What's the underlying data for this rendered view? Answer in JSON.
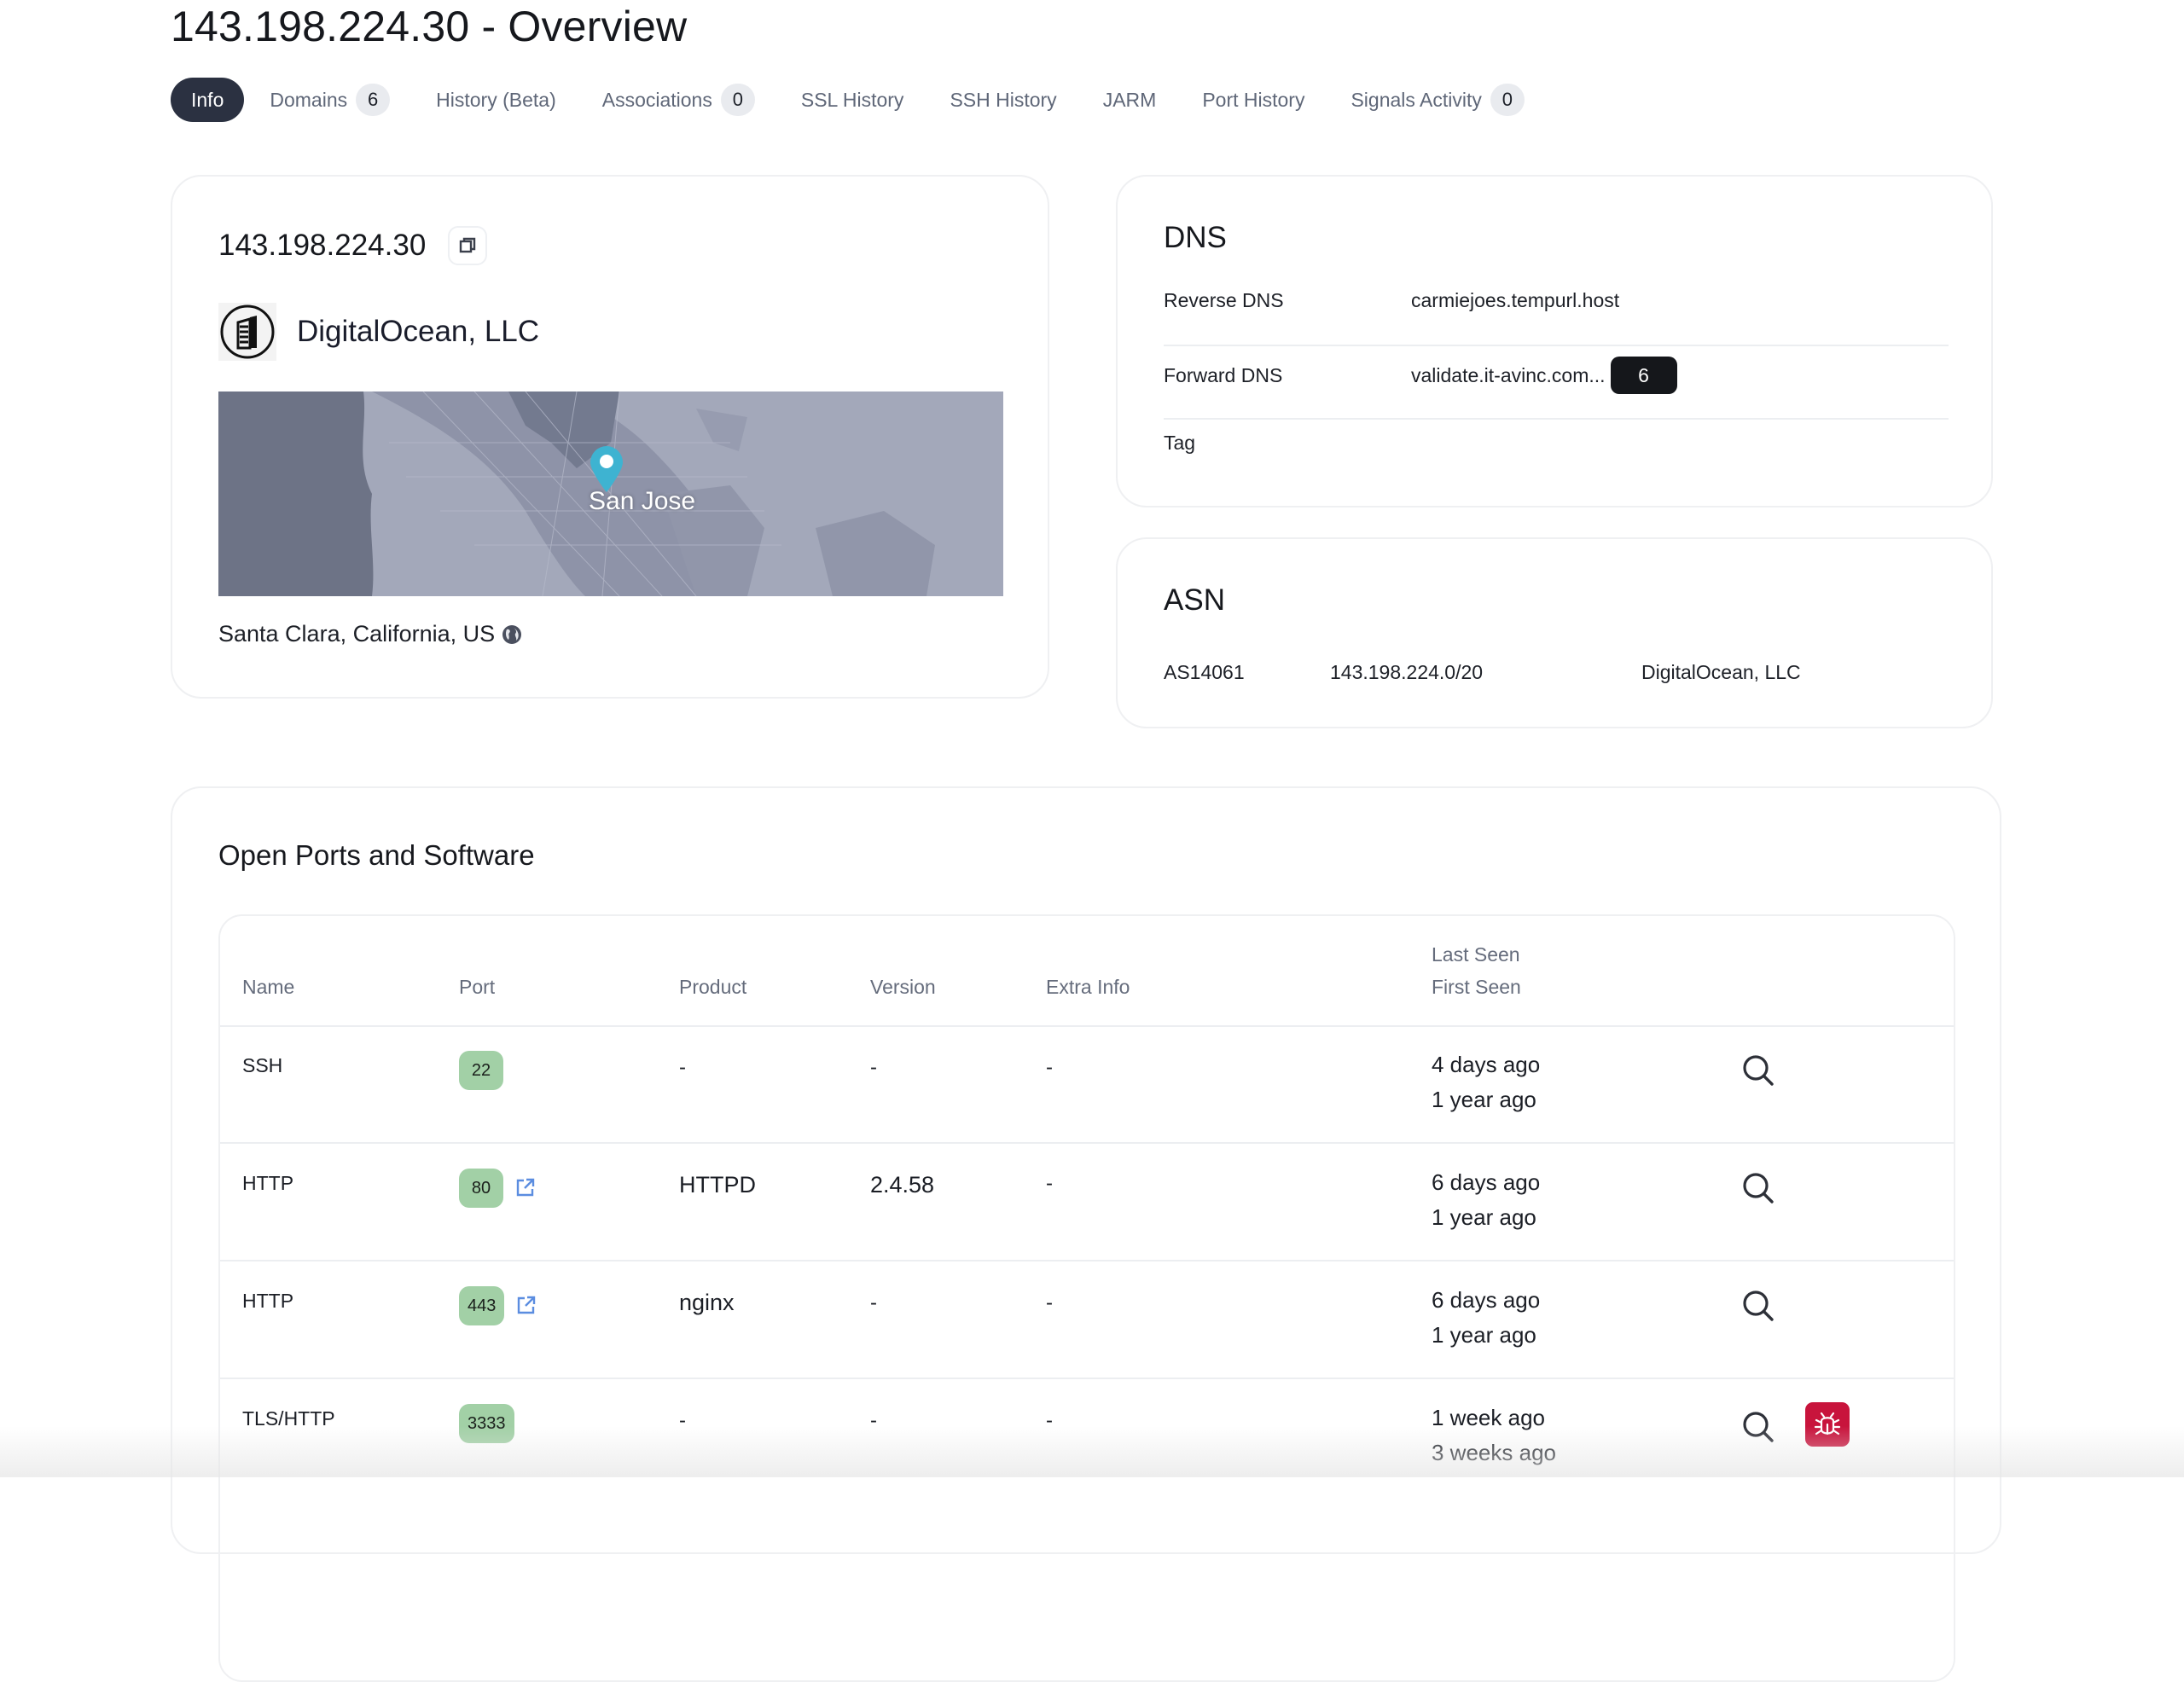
{
  "page": {
    "title": "143.198.224.30 - Overview"
  },
  "tabs": [
    {
      "label": "Info",
      "active": true
    },
    {
      "label": "Domains",
      "count": "6"
    },
    {
      "label": "History (Beta)"
    },
    {
      "label": "Associations",
      "count": "0"
    },
    {
      "label": "SSL History"
    },
    {
      "label": "SSH History"
    },
    {
      "label": "JARM"
    },
    {
      "label": "Port History"
    },
    {
      "label": "Signals Activity",
      "count": "0"
    }
  ],
  "ip_card": {
    "ip": "143.198.224.30",
    "copy_icon": "copy-icon",
    "org_icon": "building-icon",
    "org_name": "DigitalOcean, LLC",
    "map_label": "San Jose",
    "location": "Santa Clara, California, US",
    "location_icon": "globe-icon",
    "pin_color": "#3eb3d1"
  },
  "dns": {
    "title": "DNS",
    "rows": [
      {
        "key": "Reverse DNS",
        "value": "carmiejoes.tempurl.host"
      },
      {
        "key": "Forward DNS",
        "value": "validate.it-avinc.com...",
        "count": "6"
      },
      {
        "key": "Tag",
        "value": ""
      }
    ]
  },
  "asn": {
    "title": "ASN",
    "number": "AS14061",
    "range": "143.198.224.0/20",
    "org": "DigitalOcean, LLC"
  },
  "ports": {
    "title": "Open Ports and Software",
    "columns": {
      "name": "Name",
      "port": "Port",
      "product": "Product",
      "version": "Version",
      "extra": "Extra Info",
      "last_seen": "Last Seen",
      "first_seen": "First Seen"
    },
    "rows": [
      {
        "name": "SSH",
        "port": "22",
        "external_link": false,
        "product": "-",
        "version": "-",
        "extra": "-",
        "last_seen": "4 days ago",
        "first_seen": "1 year ago",
        "vuln": false
      },
      {
        "name": "HTTP",
        "port": "80",
        "external_link": true,
        "product": "HTTPD",
        "version": "2.4.58",
        "extra": "-",
        "last_seen": "6 days ago",
        "first_seen": "1 year ago",
        "vuln": false
      },
      {
        "name": "HTTP",
        "port": "443",
        "external_link": true,
        "product": "nginx",
        "version": "-",
        "extra": "-",
        "last_seen": "6 days ago",
        "first_seen": "1 year ago",
        "vuln": false
      },
      {
        "name": "TLS/HTTP",
        "port": "3333",
        "external_link": false,
        "product": "-",
        "version": "-",
        "extra": "-",
        "last_seen": "1 week ago",
        "first_seen": "3 weeks ago",
        "vuln": true
      }
    ]
  },
  "colors": {
    "active_tab": "#2b3141",
    "port_badge": "#a2d0a6",
    "vuln_badge": "#c8143c",
    "link_blue": "#5b8de0"
  }
}
